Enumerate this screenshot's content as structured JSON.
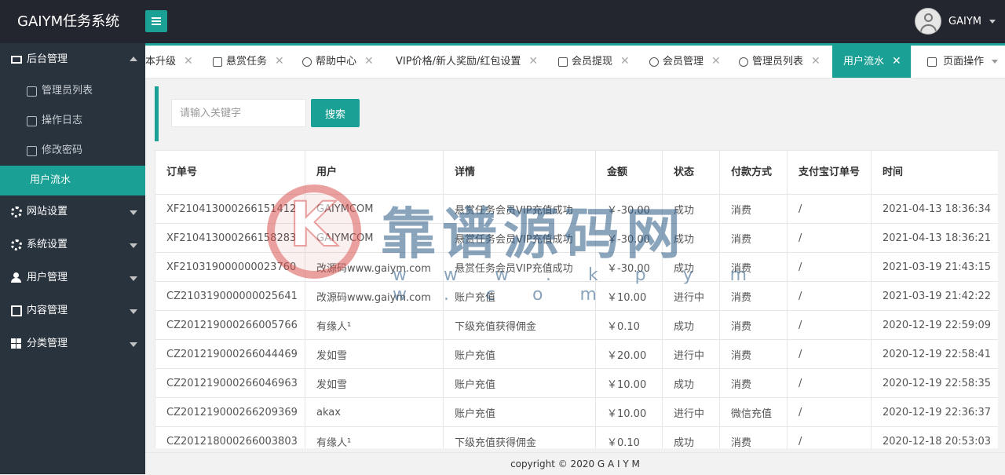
{
  "app": {
    "title": "GAIYM任务系统"
  },
  "user": {
    "name": "GAIYM"
  },
  "sidebar": {
    "groups": [
      {
        "label": "后台管理",
        "expanded": true,
        "items": [
          {
            "label": "管理员列表"
          },
          {
            "label": "操作日志"
          },
          {
            "label": "修改密码"
          },
          {
            "label": "用户流水",
            "active": true
          }
        ]
      },
      {
        "label": "网站设置"
      },
      {
        "label": "系统设置"
      },
      {
        "label": "用户管理"
      },
      {
        "label": "内容管理"
      },
      {
        "label": "分类管理"
      }
    ]
  },
  "tabs": [
    {
      "label": "本升级"
    },
    {
      "label": "悬赏任务"
    },
    {
      "label": "帮助中心"
    },
    {
      "label": "VIP价格/新人奖励/红包设置"
    },
    {
      "label": "会员提现"
    },
    {
      "label": "会员管理"
    },
    {
      "label": "管理员列表"
    },
    {
      "label": "用户流水",
      "active": true
    }
  ],
  "tab_ops": {
    "label": "页面操作"
  },
  "search": {
    "placeholder": "请输入关键字",
    "button": "搜索"
  },
  "table": {
    "headers": [
      "订单号",
      "用户",
      "详情",
      "金额",
      "状态",
      "付款方式",
      "支付宝订单号",
      "时间"
    ],
    "rows": [
      [
        "XF210413000266151412",
        "GAIYMCOM",
        "悬赏任务会员VIP充值成功",
        "￥-30.00",
        "成功",
        "消费",
        "/",
        "2021-04-13 18:36:34"
      ],
      [
        "XF210413000266158283",
        "GAIYMCOM",
        "悬赏任务会员VIP充值成功",
        "￥-30.00",
        "成功",
        "消费",
        "/",
        "2021-04-13 18:36:21"
      ],
      [
        "XF210319000000023760",
        "改源码www.gaiym.com",
        "悬赏任务会员VIP充值成功",
        "￥-30.00",
        "成功",
        "消费",
        "/",
        "2021-03-19 21:43:15"
      ],
      [
        "CZ210319000000025641",
        "改源码www.gaiym.com",
        "账户充值",
        "￥10.00",
        "进行中",
        "消费",
        "/",
        "2021-03-19 21:42:22"
      ],
      [
        "CZ201219000266005766",
        "有缘人¹",
        "下级充值获得佣金",
        "￥0.10",
        "成功",
        "消费",
        "/",
        "2020-12-19 22:59:09"
      ],
      [
        "CZ201219000266044469",
        "发如雪",
        "账户充值",
        "￥20.00",
        "进行中",
        "消费",
        "/",
        "2020-12-19 22:58:41"
      ],
      [
        "CZ201219000266046963",
        "发如雪",
        "账户充值",
        "￥10.00",
        "成功",
        "消费",
        "/",
        "2020-12-19 22:58:35"
      ],
      [
        "CZ201219000266209369",
        "akax",
        "账户充值",
        "￥10.00",
        "进行中",
        "微信充值",
        "/",
        "2020-12-19 22:36:37"
      ],
      [
        "CZ201218000266003803",
        "有缘人¹",
        "下级充值获得佣金",
        "￥0.10",
        "成功",
        "消费",
        "/",
        "2020-12-18 20:53:03"
      ]
    ]
  },
  "footer": {
    "text": "copyright © 2020 G A I Y M"
  },
  "watermark": {
    "letter": "K",
    "text": "靠谱源码网",
    "url": "w w w . k p y m w . c o m"
  },
  "colors": {
    "accent": "#1aa094",
    "header_bg": "#23262e",
    "sidebar_bg": "#28333e"
  }
}
